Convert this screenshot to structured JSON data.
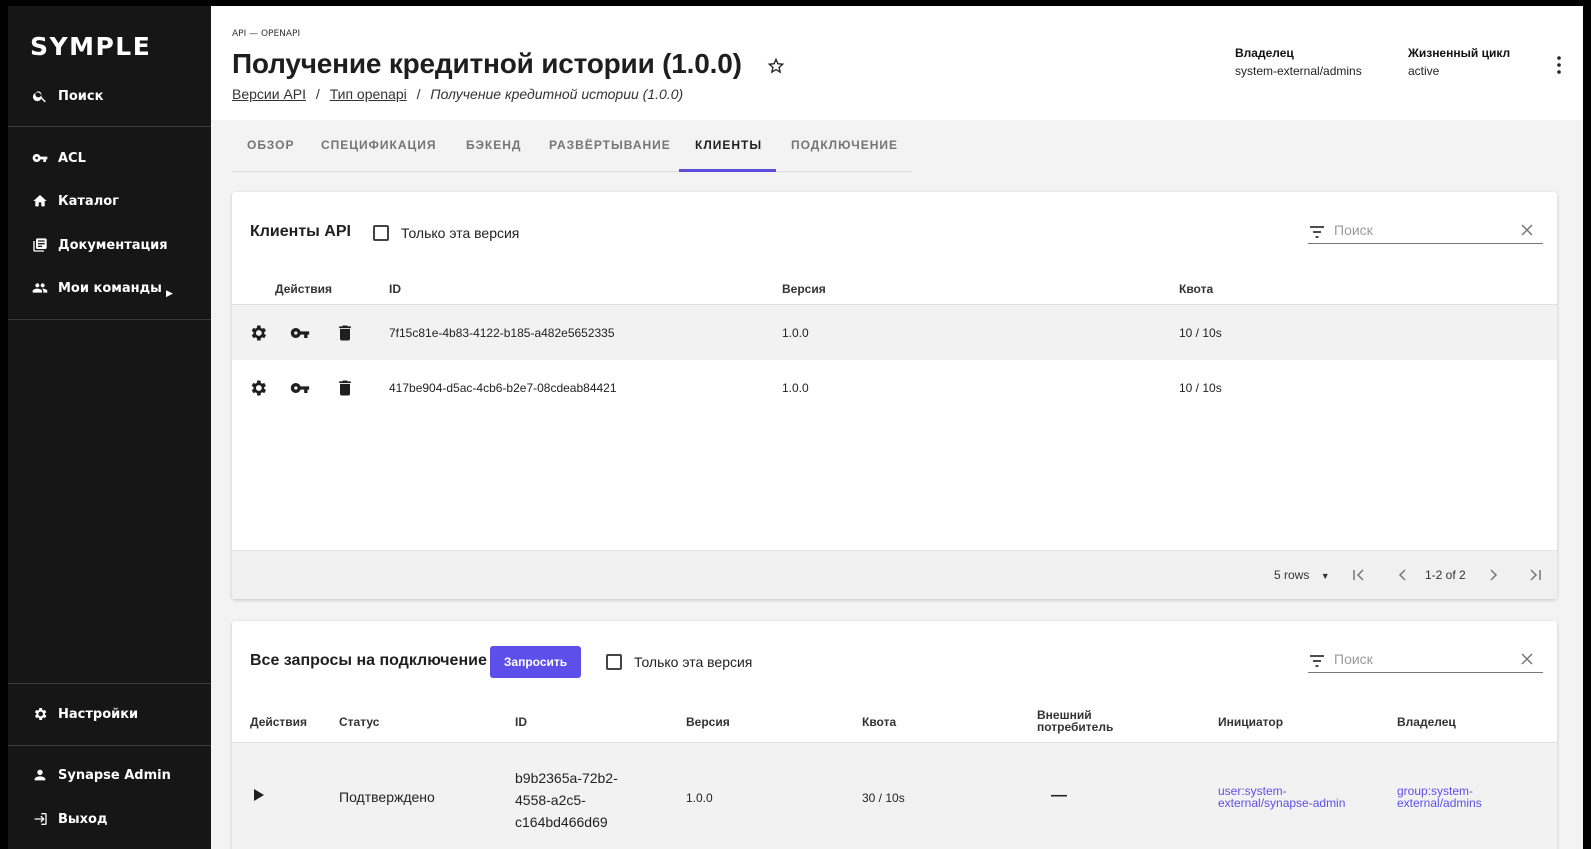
{
  "sidebar": {
    "logo": "SYMPLE",
    "search_label": "Поиск",
    "items": [
      {
        "label": "ACL",
        "icon": "key-icon"
      },
      {
        "label": "Каталог",
        "icon": "home-icon"
      },
      {
        "label": "Документация",
        "icon": "library-books-icon"
      },
      {
        "label": "Мои команды",
        "icon": "group-icon"
      }
    ],
    "settings_label": "Настройки",
    "user_label": "Synapse Admin",
    "logout_label": "Выход"
  },
  "header": {
    "kind": "API — OPENAPI",
    "title": "Получение кредитной истории (1.0.0)",
    "breadcrumbs": {
      "link1": "Версии API",
      "sep1": "/",
      "link2": "Тип openapi",
      "sep2": "/",
      "current": "Получение кредитной истории (1.0.0)"
    },
    "owner_label": "Владелец",
    "owner_value": "system-external/admins",
    "lifecycle_label": "Жизненный цикл",
    "lifecycle_value": "active"
  },
  "tabs": [
    "ОБЗОР",
    "СПЕЦИФИКАЦИЯ",
    "БЭКЕНД",
    "РАЗВЁРТЫВАНИЕ",
    "КЛИЕНТЫ",
    "ПОДКЛЮЧЕНИЕ"
  ],
  "active_tab": "КЛИЕНТЫ",
  "clients": {
    "title": "Клиенты API",
    "only_version_label": "Только эта версия",
    "search_placeholder": "Поиск",
    "columns": [
      "Действия",
      "ID",
      "Версия",
      "Квота"
    ],
    "rows": [
      {
        "id": "7f15c81e-4b83-4122-b185-a482e5652335",
        "version": "1.0.0",
        "quota": "10 / 10s"
      },
      {
        "id": "417be904-d5ac-4cb6-b2e7-08cdeab84421",
        "version": "1.0.0",
        "quota": "10 / 10s"
      }
    ],
    "pager": {
      "rows_label": "5 rows",
      "range": "1-2 of 2"
    }
  },
  "requests": {
    "title": "Все запросы на подключение",
    "request_button": "Запросить",
    "only_version_label": "Только эта версия",
    "search_placeholder": "Поиск",
    "columns": [
      "Действия",
      "Статус",
      "ID",
      "Версия",
      "Квота",
      "Внешний",
      "потребитель",
      "Инициатор",
      "Владелец"
    ],
    "rows": [
      {
        "status": "Подтверждено",
        "id_lines": [
          "b9b2365a-72b2-",
          "4558-a2c5-",
          "c164bd466d69"
        ],
        "version": "1.0.0",
        "quota": "30 / 10s",
        "external": "—",
        "initiator_lines": [
          "user:system-",
          "external/synapse-admin"
        ],
        "owner_lines": [
          "group:system-",
          "external/admins"
        ]
      }
    ]
  },
  "colors": {
    "accent": "#5d4fea",
    "sidebar": "#161616"
  }
}
